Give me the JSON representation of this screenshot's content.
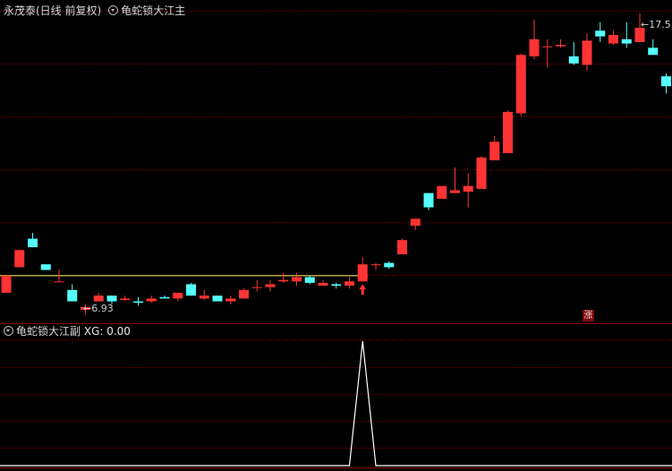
{
  "header_top": {
    "stock": "永茂泰(日线 前复权)",
    "indicator": "龟蛇锁大江主"
  },
  "header_bottom": {
    "indicator": "龟蛇锁大江副",
    "xg_text": "XG: 0.00"
  },
  "labels": {
    "low": "6.93",
    "high": "17.5",
    "zhang": "涨"
  },
  "colors": {
    "up": "#ff3333",
    "down": "#55ffff",
    "grid": "#8b0000",
    "support_line": "#ffff66",
    "indicator_line": "#ffffff",
    "signal_arrow": "#ff3333"
  },
  "chart_data": [
    {
      "type": "candlestick",
      "title": "永茂泰(日线 前复权)",
      "ylim": [
        6.6,
        17.6
      ],
      "grid": true,
      "support_level": 8.3,
      "low_marker": 6.93,
      "high_marker": 17.5,
      "signal_index": 27,
      "candles": [
        {
          "o": 7.7,
          "h": 8.3,
          "l": 7.7,
          "c": 8.3
        },
        {
          "o": 8.6,
          "h": 9.2,
          "l": 8.6,
          "c": 9.2
        },
        {
          "o": 9.6,
          "h": 9.8,
          "l": 9.3,
          "c": 9.3
        },
        {
          "o": 8.7,
          "h": 8.7,
          "l": 8.5,
          "c": 8.5
        },
        {
          "o": 8.1,
          "h": 8.5,
          "l": 8.1,
          "c": 8.1
        },
        {
          "o": 7.8,
          "h": 8.0,
          "l": 7.4,
          "c": 7.4
        },
        {
          "o": 7.1,
          "h": 7.3,
          "l": 6.93,
          "c": 7.2
        },
        {
          "o": 7.4,
          "h": 7.7,
          "l": 7.4,
          "c": 7.6
        },
        {
          "o": 7.6,
          "h": 7.6,
          "l": 7.3,
          "c": 7.4
        },
        {
          "o": 7.45,
          "h": 7.6,
          "l": 7.4,
          "c": 7.5
        },
        {
          "o": 7.4,
          "h": 7.55,
          "l": 7.25,
          "c": 7.35
        },
        {
          "o": 7.4,
          "h": 7.6,
          "l": 7.35,
          "c": 7.5
        },
        {
          "o": 7.55,
          "h": 7.6,
          "l": 7.5,
          "c": 7.5
        },
        {
          "o": 7.5,
          "h": 7.7,
          "l": 7.4,
          "c": 7.7
        },
        {
          "o": 8.0,
          "h": 8.05,
          "l": 7.6,
          "c": 7.6
        },
        {
          "o": 7.5,
          "h": 7.8,
          "l": 7.45,
          "c": 7.6
        },
        {
          "o": 7.6,
          "h": 7.6,
          "l": 7.4,
          "c": 7.4
        },
        {
          "o": 7.4,
          "h": 7.6,
          "l": 7.3,
          "c": 7.5
        },
        {
          "o": 7.5,
          "h": 7.85,
          "l": 7.5,
          "c": 7.8
        },
        {
          "o": 7.9,
          "h": 8.15,
          "l": 7.75,
          "c": 7.9
        },
        {
          "o": 7.9,
          "h": 8.15,
          "l": 7.75,
          "c": 8.0
        },
        {
          "o": 8.1,
          "h": 8.4,
          "l": 8.05,
          "c": 8.15
        },
        {
          "o": 8.1,
          "h": 8.4,
          "l": 7.95,
          "c": 8.25
        },
        {
          "o": 8.25,
          "h": 8.3,
          "l": 8.0,
          "c": 8.05
        },
        {
          "o": 7.95,
          "h": 8.15,
          "l": 7.95,
          "c": 8.05
        },
        {
          "o": 8.0,
          "h": 8.05,
          "l": 7.85,
          "c": 7.95
        },
        {
          "o": 7.95,
          "h": 8.25,
          "l": 7.85,
          "c": 8.1
        },
        {
          "o": 8.1,
          "h": 8.95,
          "l": 8.1,
          "c": 8.7
        },
        {
          "o": 8.7,
          "h": 8.75,
          "l": 8.5,
          "c": 8.7
        },
        {
          "o": 8.75,
          "h": 8.8,
          "l": 8.55,
          "c": 8.6
        },
        {
          "o": 9.05,
          "h": 9.6,
          "l": 9.05,
          "c": 9.55
        },
        {
          "o": 10.05,
          "h": 10.3,
          "l": 9.9,
          "c": 10.3
        },
        {
          "o": 11.2,
          "h": 11.2,
          "l": 10.6,
          "c": 10.7
        },
        {
          "o": 11.0,
          "h": 11.45,
          "l": 11.0,
          "c": 11.45
        },
        {
          "o": 11.2,
          "h": 12.1,
          "l": 11.2,
          "c": 11.3
        },
        {
          "o": 11.25,
          "h": 11.9,
          "l": 10.7,
          "c": 11.45
        },
        {
          "o": 11.35,
          "h": 12.5,
          "l": 11.35,
          "c": 12.45
        },
        {
          "o": 12.35,
          "h": 13.2,
          "l": 12.35,
          "c": 13.0
        },
        {
          "o": 12.6,
          "h": 14.1,
          "l": 12.6,
          "c": 14.05
        },
        {
          "o": 14.0,
          "h": 16.1,
          "l": 13.9,
          "c": 16.05
        },
        {
          "o": 16.0,
          "h": 17.3,
          "l": 15.9,
          "c": 16.6
        },
        {
          "o": 16.35,
          "h": 16.6,
          "l": 15.6,
          "c": 16.35
        },
        {
          "o": 16.35,
          "h": 16.6,
          "l": 16.3,
          "c": 16.4
        },
        {
          "o": 16.0,
          "h": 16.5,
          "l": 15.7,
          "c": 15.75
        },
        {
          "o": 15.7,
          "h": 16.8,
          "l": 15.5,
          "c": 16.55
        },
        {
          "o": 16.9,
          "h": 17.2,
          "l": 16.5,
          "c": 16.7
        },
        {
          "o": 16.45,
          "h": 16.9,
          "l": 16.4,
          "c": 16.75
        },
        {
          "o": 16.6,
          "h": 17.2,
          "l": 16.3,
          "c": 16.45
        },
        {
          "o": 16.5,
          "h": 17.5,
          "l": 16.5,
          "c": 17.0
        },
        {
          "o": 16.3,
          "h": 16.6,
          "l": 16.05,
          "c": 16.05
        },
        {
          "o": 15.3,
          "h": 15.4,
          "l": 14.7,
          "c": 14.95
        }
      ]
    },
    {
      "type": "line",
      "title": "龟蛇锁大江副",
      "ylim": [
        0,
        1
      ],
      "values": [
        0,
        0,
        0,
        0,
        0,
        0,
        0,
        0,
        0,
        0,
        0,
        0,
        0,
        0,
        0,
        0,
        0,
        0,
        0,
        0,
        0,
        0,
        0,
        0,
        0,
        0,
        0,
        1,
        0,
        0,
        0,
        0,
        0,
        0,
        0,
        0,
        0,
        0,
        0,
        0,
        0,
        0,
        0,
        0,
        0,
        0,
        0,
        0,
        0,
        0,
        0
      ]
    }
  ]
}
